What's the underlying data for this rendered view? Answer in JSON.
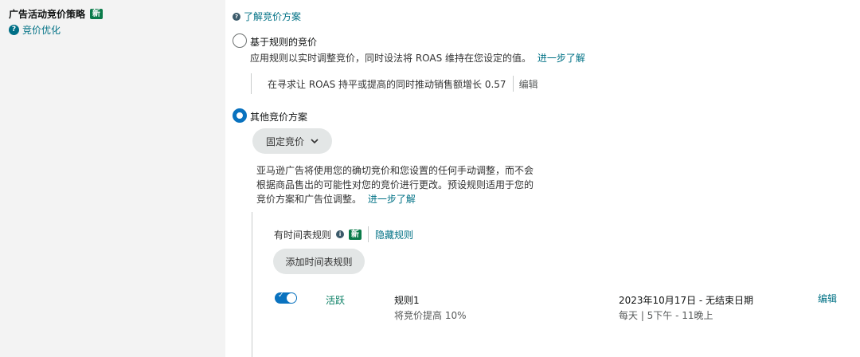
{
  "sidebar": {
    "title": "广告活动竞价策略",
    "new_badge": "新",
    "help_link": "竞价优化"
  },
  "main": {
    "learn_link": "了解竞价方案",
    "option_rule": {
      "label": "基于规则的竞价",
      "desc": "应用规则以实时调整竞价，同时设法将 ROAS 维持在您设定的值。",
      "learn_more": "进一步了解",
      "checked": false,
      "rule_text": "在寻求让 ROAS 持平或提高的同时推动销售额增长 0.57",
      "rule_edit": "编辑"
    },
    "option_other": {
      "label": "其他竞价方案",
      "checked": true,
      "dropdown_value": "固定竞价",
      "desc_line1": "亚马逊广告将使用您的确切竞价和您设置的任何手动调整，而不会",
      "desc_line2": "根据商品售出的可能性对您的竞价进行更改。预设规则适用于您的",
      "desc_line3": "竞价方案和广告位调整。",
      "learn_more": "进一步了解"
    },
    "schedule": {
      "title": "有时间表规则",
      "new_badge": "新",
      "hide_link": "隐藏规则",
      "add_button": "添加时间表规则",
      "rules": [
        {
          "enabled": true,
          "status": "活跃",
          "name": "规则1",
          "detail": "将竞价提高 10%",
          "date_range": "2023年10月17日 - 无结束日期",
          "time": "每天 | 5下午 - 11晚上",
          "edit": "编辑"
        }
      ]
    }
  },
  "colors": {
    "accent": "#0972bf",
    "link": "#007185",
    "new_badge": "#0b7b4a",
    "active": "#067d62",
    "sidebar_bg": "#f3f3f3"
  }
}
